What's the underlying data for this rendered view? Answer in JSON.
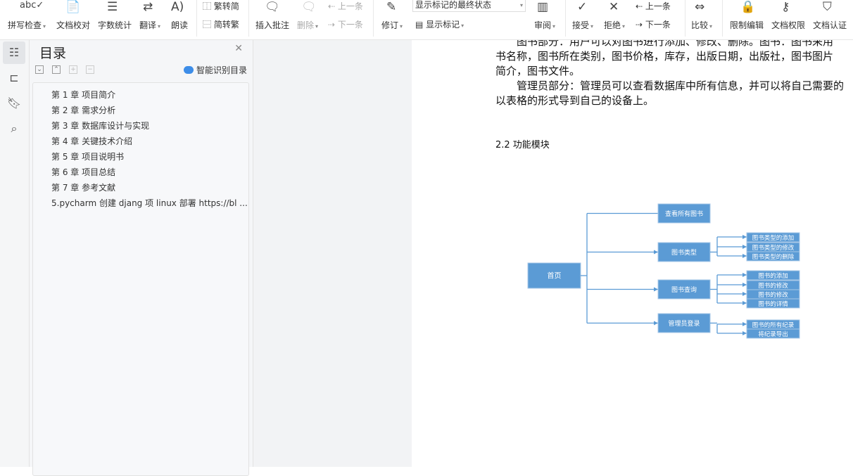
{
  "toolbar": {
    "spell_check": "拼写检查",
    "doc_proof": "文档校对",
    "word_count": "字数统计",
    "translate": "翻译",
    "read_aloud": "朗读",
    "trad_to_simp": "繁转简",
    "simp_to_trad": "简转繁",
    "insert_comment": "插入批注",
    "delete": "删除",
    "prev_comment": "上一条",
    "next_comment": "下一条",
    "revise": "修订",
    "markup_state": "显示标记的最终状态",
    "show_markup": "显示标记",
    "review": "审阅",
    "accept": "接受",
    "reject": "拒绝",
    "prev_change": "上一条",
    "next_change": "下一条",
    "compare": "比较",
    "restrict_edit": "限制编辑",
    "doc_permission": "文档权限",
    "doc_certify": "文档认证"
  },
  "sidebar": {
    "title": "目录",
    "smart_toc": "智能识别目录",
    "items": [
      "第 1 章  项目简介",
      "第 2 章  需求分析",
      "第 3 章  数据库设计与实现",
      "第 4 章  关键技术介绍",
      "第 5 章  项目说明书",
      "第 6 章  项目总结",
      "第 7 章  参考文献",
      "5.pycharm 创建 djang 项 linux 部署 https://bl ..."
    ]
  },
  "document": {
    "lines": [
      "图书部分：用户可以对图书进行添加、修改、删除。图书：图书采用",
      "书名称，图书所在类别，图书价格，库存，出版日期，出版社，图书图片",
      "简介，图书文件。",
      "管理员部分：管理员可以查看数据库中所有信息，并可以将自己需要的",
      "以表格的形式导到自己的设备上。"
    ],
    "heading": "2.2  功能模块",
    "diagram": {
      "color": "#5b9bd5",
      "root": "首页",
      "branches": [
        {
          "label": "查看所有图书",
          "children": []
        },
        {
          "label": "图书类型",
          "children": [
            "图书类型的添加",
            "图书类型的修改",
            "图书类型的删除"
          ]
        },
        {
          "label": "图书查询",
          "children": [
            "图书的添加",
            "图书的修改",
            "图书的修改",
            "图书的详情"
          ]
        },
        {
          "label": "管理员登录",
          "children": [
            "图书的所有纪录",
            "将纪录导出"
          ]
        }
      ]
    }
  }
}
